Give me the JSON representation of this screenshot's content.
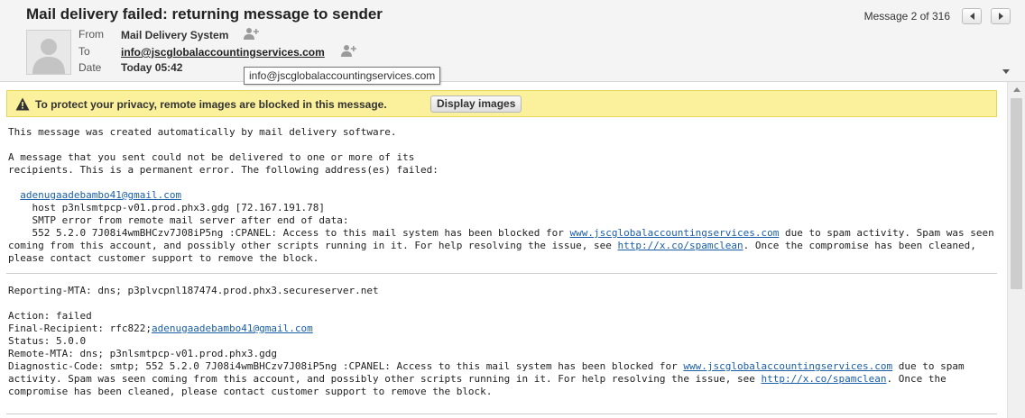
{
  "header": {
    "subject": "Mail delivery failed: returning message to sender",
    "counter": "Message 2 of 316",
    "from_label": "From",
    "to_label": "To",
    "date_label": "Date",
    "from_value": "Mail Delivery System",
    "to_value": "info@jscglobalaccountingservices.com",
    "date_value": "Today 05:42",
    "tooltip": "info@jscglobalaccountingservices.com"
  },
  "privacy": {
    "text": "To protect your privacy, remote images are blocked in this message.",
    "button": "Display images"
  },
  "body": {
    "line1": "This message was created automatically by mail delivery software.",
    "line2": "A message that you sent could not be delivered to one or more of its",
    "line3": "recipients. This is a permanent error. The following address(es) failed:",
    "recipient": "adenugaadebambo41@gmail.com",
    "host_line": "host p3nlsmtpcp-v01.prod.phx3.gdg [72.167.191.78]",
    "smtp_line": "SMTP error from remote mail server after end of data:",
    "error_pre": "552 5.2.0 7J08i4wmBHCzv7J08iP5ng :CPANEL: Access to this mail system has been blocked for ",
    "domain_link": "www.jscglobalaccountingservices.com",
    "error_post": " due to spam activity. Spam was seen",
    "error_line2_pre": "coming from this account, and possibly other scripts running in it. For help resolving the issue, see ",
    "spamclean_link": "http://x.co/spamclean",
    "error_line2_post": ". Once the compromise has been cleaned,",
    "error_line3": "please contact customer support to remove the block."
  },
  "report": {
    "reporting_mta": "Reporting-MTA: dns; p3plvcpnl187474.prod.phx3.secureserver.net",
    "action": "Action: failed",
    "final_recipient_pre": "Final-Recipient: rfc822;",
    "final_recipient_link": "adenugaadebambo41@gmail.com",
    "status": "Status: 5.0.0",
    "remote_mta": "Remote-MTA: dns; p3nlsmtpcp-v01.prod.phx3.gdg",
    "diag_pre": "Diagnostic-Code: smtp; 552 5.2.0 7J08i4wmBHCzv7J08iP5ng :CPANEL: Access to this mail system has been blocked for ",
    "diag_link": "www.jscglobalaccountingservices.com",
    "diag_post": " due to spam",
    "diag_line2_pre": "activity. Spam was seen coming from this account, and possibly other scripts running in it. For help resolving the issue, see ",
    "diag_spam_link": "http://x.co/spamclean",
    "diag_line2_post": ". Once the",
    "diag_line3": "compromise has been cleaned, please contact customer support to remove the block."
  },
  "colors": {
    "link": "#1a5ea8",
    "warning_bg": "#fbf09b",
    "header_bg": "#f4f4f4"
  },
  "icons": [
    "avatar-placeholder",
    "add-contact-icon",
    "warning-icon",
    "arrow-left-icon",
    "arrow-right-icon"
  ]
}
